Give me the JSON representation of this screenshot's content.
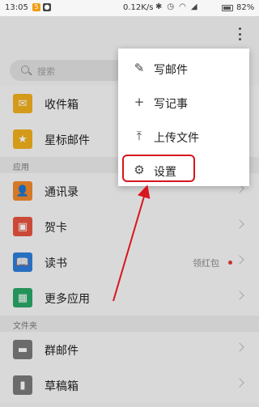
{
  "status_bar": {
    "time": "13:05",
    "network_speed": "0.12K/s",
    "battery": "82%"
  },
  "search": {
    "placeholder": "搜索"
  },
  "list": {
    "inbox": "收件箱",
    "starred": "星标邮件",
    "section_apps": "应用",
    "contacts": "通讯录",
    "greeting_cards": "贺卡",
    "reading": "读书",
    "reading_extra": "领红包",
    "more_apps": "更多应用",
    "section_folders": "文件夹",
    "group_mail": "群邮件",
    "drafts": "草稿箱"
  },
  "popup_menu": {
    "compose": "写邮件",
    "note": "写记事",
    "upload": "上传文件",
    "settings": "设置"
  },
  "colors": {
    "inbox_icon": "#f2b01e",
    "starred_icon": "#f2b01e",
    "contacts_icon": "#f28a2e",
    "cards_icon": "#e8543f",
    "reading_icon": "#2f7fdc",
    "apps_icon": "#2aa866",
    "highlight": "#d7161e"
  },
  "icons": {
    "compose": "edit-icon",
    "note": "plus-icon",
    "upload": "upload-icon",
    "settings": "gear-icon",
    "more": "kebab-icon"
  }
}
